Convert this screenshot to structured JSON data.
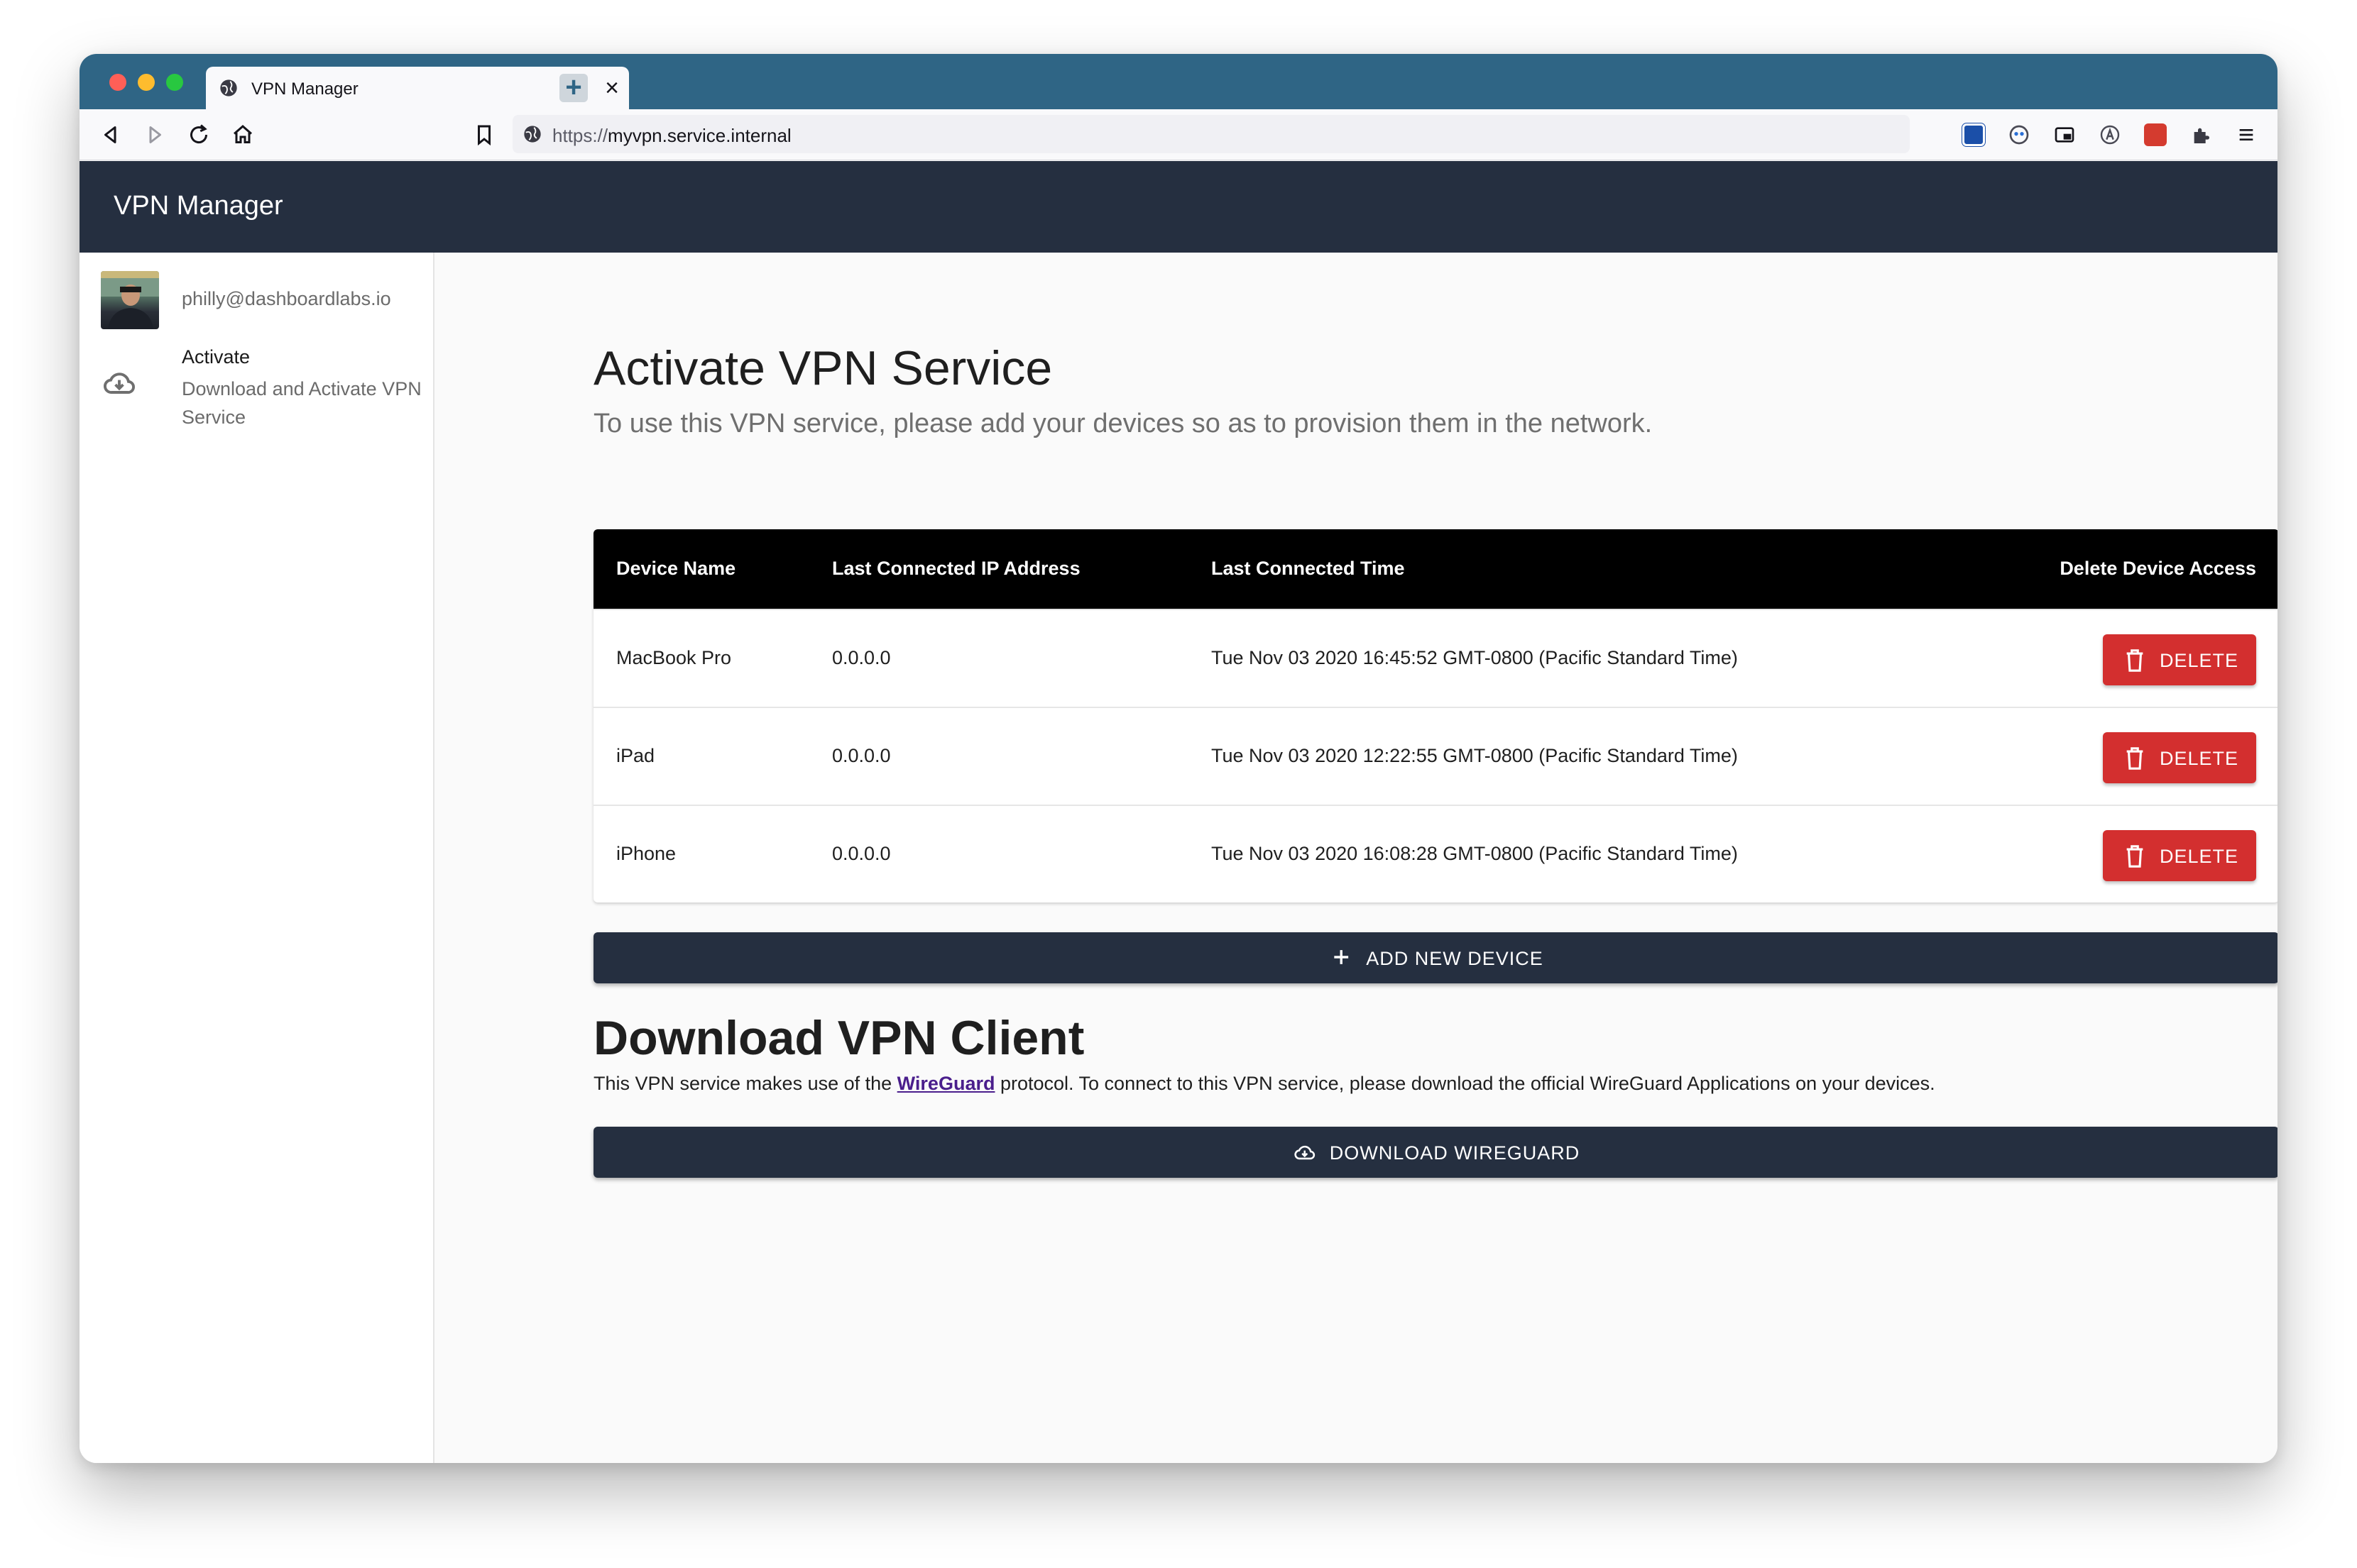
{
  "browser": {
    "tab_title": "VPN Manager",
    "tab_close": "×",
    "new_tab": "+",
    "url_protocol": "https://",
    "url_host": "myvpn.service.internal"
  },
  "app": {
    "title": "VPN Manager"
  },
  "sidebar": {
    "user_email": "philly@dashboardlabs.io",
    "items": [
      {
        "label": "Activate",
        "description": "Download and Activate VPN Service",
        "icon": "cloud-download-icon"
      }
    ]
  },
  "activate": {
    "heading": "Activate VPN Service",
    "subtitle": "To use this VPN service, please add your devices so as to provision them in the network.",
    "table": {
      "headers": {
        "device_name": "Device Name",
        "ip": "Last Connected IP Address",
        "time": "Last Connected Time",
        "delete": "Delete Device Access"
      },
      "rows": [
        {
          "device": "MacBook Pro",
          "ip": "0.0.0.0",
          "time": "Tue Nov 03 2020 16:45:52 GMT-0800 (Pacific Standard Time)",
          "action": "DELETE"
        },
        {
          "device": "iPad",
          "ip": "0.0.0.0",
          "time": "Tue Nov 03 2020 12:22:55 GMT-0800 (Pacific Standard Time)",
          "action": "DELETE"
        },
        {
          "device": "iPhone",
          "ip": "0.0.0.0",
          "time": "Tue Nov 03 2020 16:08:28 GMT-0800 (Pacific Standard Time)",
          "action": "DELETE"
        }
      ]
    },
    "add_button": "ADD NEW DEVICE"
  },
  "download": {
    "heading": "Download VPN Client",
    "text_before": "This VPN service makes use of the ",
    "link": "WireGuard",
    "text_after": " protocol. To connect to this VPN service, please download the official WireGuard Applications on your devices.",
    "button": "DOWNLOAD WIREGUARD"
  },
  "colors": {
    "app_bar": "#252f40",
    "tab_bar": "#2f6585",
    "delete": "#d32f2f"
  }
}
